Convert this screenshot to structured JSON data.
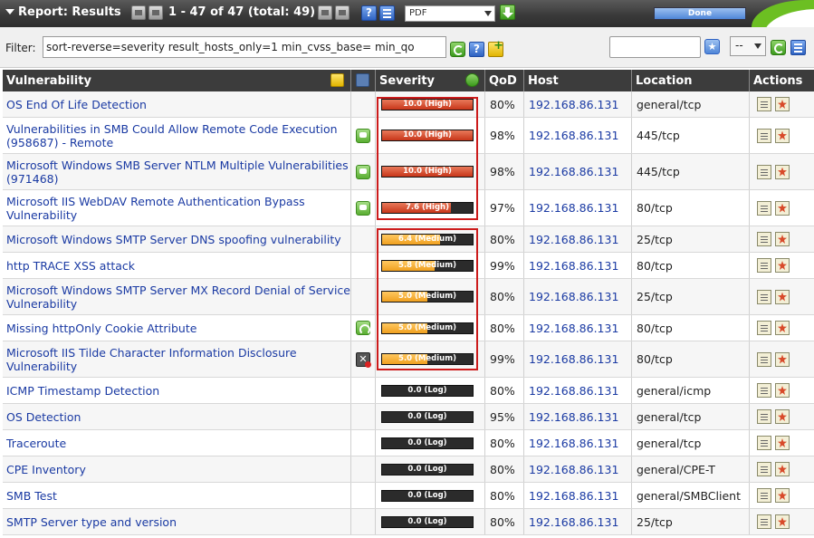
{
  "header": {
    "title": "Report: Results",
    "range": "1 - 47 of 47 (total: 49)",
    "format": "PDF",
    "progress_label": "Done",
    "progress_value": 1.0
  },
  "filter": {
    "label": "Filter:",
    "value": "sort-reverse=severity result_hosts_only=1 min_cvss_base= min_qo",
    "search_value": "",
    "select_value": "--"
  },
  "table": {
    "columns": {
      "vulnerability": "Vulnerability",
      "severity": "Severity",
      "qod": "QoD",
      "host": "Host",
      "location": "Location",
      "actions": "Actions"
    },
    "rows": [
      {
        "name": "OS End Of Life Detection",
        "icon": "",
        "severity": "10.0 (High)",
        "score": 10.0,
        "level": "high",
        "qod": "80%",
        "host": "192.168.86.131",
        "location": "general/tcp"
      },
      {
        "name": "Vulnerabilities in SMB Could Allow Remote Code Execution (958687) - Remote",
        "icon": "note-icon",
        "severity": "10.0 (High)",
        "score": 10.0,
        "level": "high",
        "qod": "98%",
        "host": "192.168.86.131",
        "location": "445/tcp"
      },
      {
        "name": "Microsoft Windows SMB Server NTLM Multiple Vulnerabilities (971468)",
        "icon": "note-icon",
        "severity": "10.0 (High)",
        "score": 10.0,
        "level": "high",
        "qod": "98%",
        "host": "192.168.86.131",
        "location": "445/tcp"
      },
      {
        "name": "Microsoft IIS WebDAV Remote Authentication Bypass Vulnerability",
        "icon": "note-icon",
        "severity": "7.6 (High)",
        "score": 7.6,
        "level": "high",
        "qod": "97%",
        "host": "192.168.86.131",
        "location": "80/tcp"
      },
      {
        "name": "Microsoft Windows SMTP Server DNS spoofing vulnerability",
        "icon": "",
        "severity": "6.4 (Medium)",
        "score": 6.4,
        "level": "medium",
        "qod": "80%",
        "host": "192.168.86.131",
        "location": "25/tcp"
      },
      {
        "name": "http TRACE XSS attack",
        "icon": "",
        "severity": "5.8 (Medium)",
        "score": 5.8,
        "level": "medium",
        "qod": "99%",
        "host": "192.168.86.131",
        "location": "80/tcp"
      },
      {
        "name": "Microsoft Windows SMTP Server MX Record Denial of Service Vulnerability",
        "icon": "",
        "severity": "5.0 (Medium)",
        "score": 5.0,
        "level": "medium",
        "qod": "80%",
        "host": "192.168.86.131",
        "location": "25/tcp"
      },
      {
        "name": "Missing httpOnly Cookie Attribute",
        "icon": "override-icon",
        "severity": "5.0 (Medium)",
        "score": 5.0,
        "level": "medium",
        "qod": "80%",
        "host": "192.168.86.131",
        "location": "80/tcp"
      },
      {
        "name": "Microsoft IIS Tilde Character Information Disclosure Vulnerability",
        "icon": "false-positive-icon",
        "severity": "5.0 (Medium)",
        "score": 5.0,
        "level": "medium",
        "qod": "99%",
        "host": "192.168.86.131",
        "location": "80/tcp"
      },
      {
        "name": "ICMP Timestamp Detection",
        "icon": "",
        "severity": "0.0 (Log)",
        "score": 0.0,
        "level": "log",
        "qod": "80%",
        "host": "192.168.86.131",
        "location": "general/icmp"
      },
      {
        "name": "OS Detection",
        "icon": "",
        "severity": "0.0 (Log)",
        "score": 0.0,
        "level": "log",
        "qod": "95%",
        "host": "192.168.86.131",
        "location": "general/tcp"
      },
      {
        "name": "Traceroute",
        "icon": "",
        "severity": "0.0 (Log)",
        "score": 0.0,
        "level": "log",
        "qod": "80%",
        "host": "192.168.86.131",
        "location": "general/tcp"
      },
      {
        "name": "CPE Inventory",
        "icon": "",
        "severity": "0.0 (Log)",
        "score": 0.0,
        "level": "log",
        "qod": "80%",
        "host": "192.168.86.131",
        "location": "general/CPE-T"
      },
      {
        "name": "SMB Test",
        "icon": "",
        "severity": "0.0 (Log)",
        "score": 0.0,
        "level": "log",
        "qod": "80%",
        "host": "192.168.86.131",
        "location": "general/SMBClient"
      },
      {
        "name": "SMTP Server type and version",
        "icon": "",
        "severity": "0.0 (Log)",
        "score": 0.0,
        "level": "log",
        "qod": "80%",
        "host": "192.168.86.131",
        "location": "25/tcp"
      }
    ]
  },
  "colors": {
    "high": "#c8361a",
    "medium": "#f0a020",
    "highlight": "#cc1b1b",
    "link": "#1a3aa3"
  }
}
